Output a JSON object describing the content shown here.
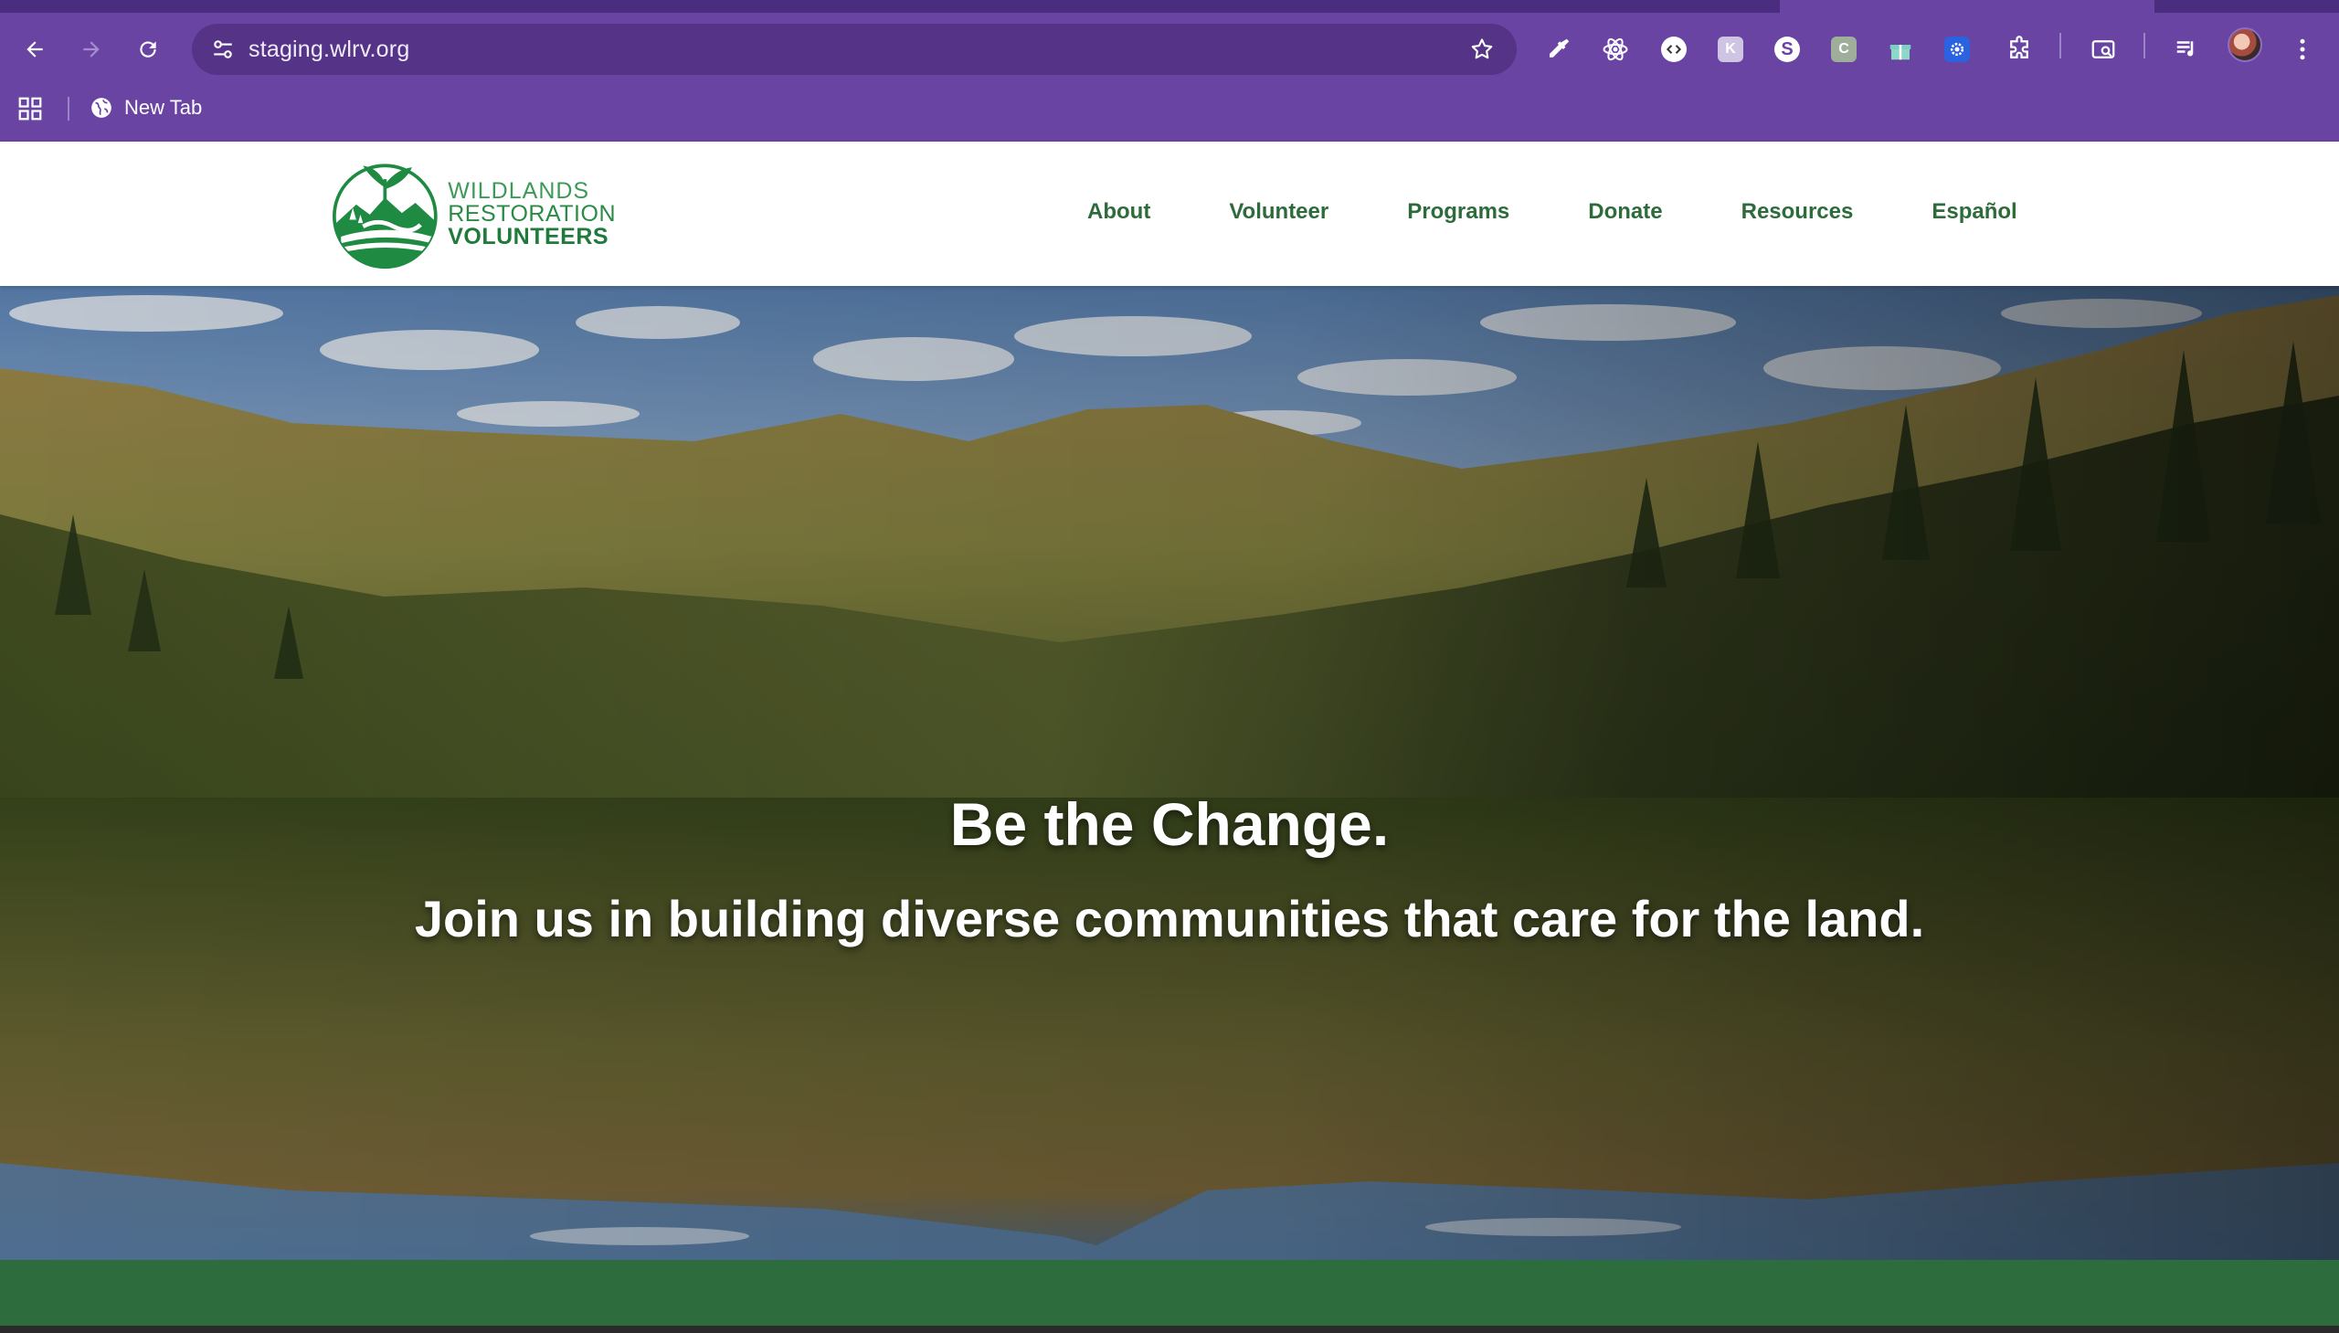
{
  "browser": {
    "url": "staging.wlrv.org",
    "bookmarks": [
      {
        "label": "New Tab"
      }
    ],
    "extensions": [
      {
        "name": "eyedropper-extension-icon"
      },
      {
        "name": "react-devtools-extension-icon"
      },
      {
        "name": "code-extension-icon"
      },
      {
        "name": "k-extension-icon"
      },
      {
        "name": "s-extension-icon"
      },
      {
        "name": "c-extension-icon"
      },
      {
        "name": "gift-extension-icon"
      },
      {
        "name": "gear-extension-icon"
      },
      {
        "name": "puzzle-extensions-icon"
      }
    ],
    "colors": {
      "frame": "#6a44a3",
      "omnibox": "#553387"
    }
  },
  "site": {
    "logo": {
      "line1": "WILDLANDS",
      "line2": "RESTORATION",
      "line3": "VOLUNTEERS"
    },
    "nav": [
      {
        "label": "About"
      },
      {
        "label": "Volunteer"
      },
      {
        "label": "Programs"
      },
      {
        "label": "Donate"
      },
      {
        "label": "Resources"
      },
      {
        "label": "Español"
      }
    ],
    "hero": {
      "title": "Be the Change.",
      "subtitle": "Join us in building diverse communities that care for the land."
    },
    "colors": {
      "brand_green": "#2a8a46",
      "nav_text": "#2e6b3a",
      "footer_band": "#2d6d3d"
    }
  }
}
